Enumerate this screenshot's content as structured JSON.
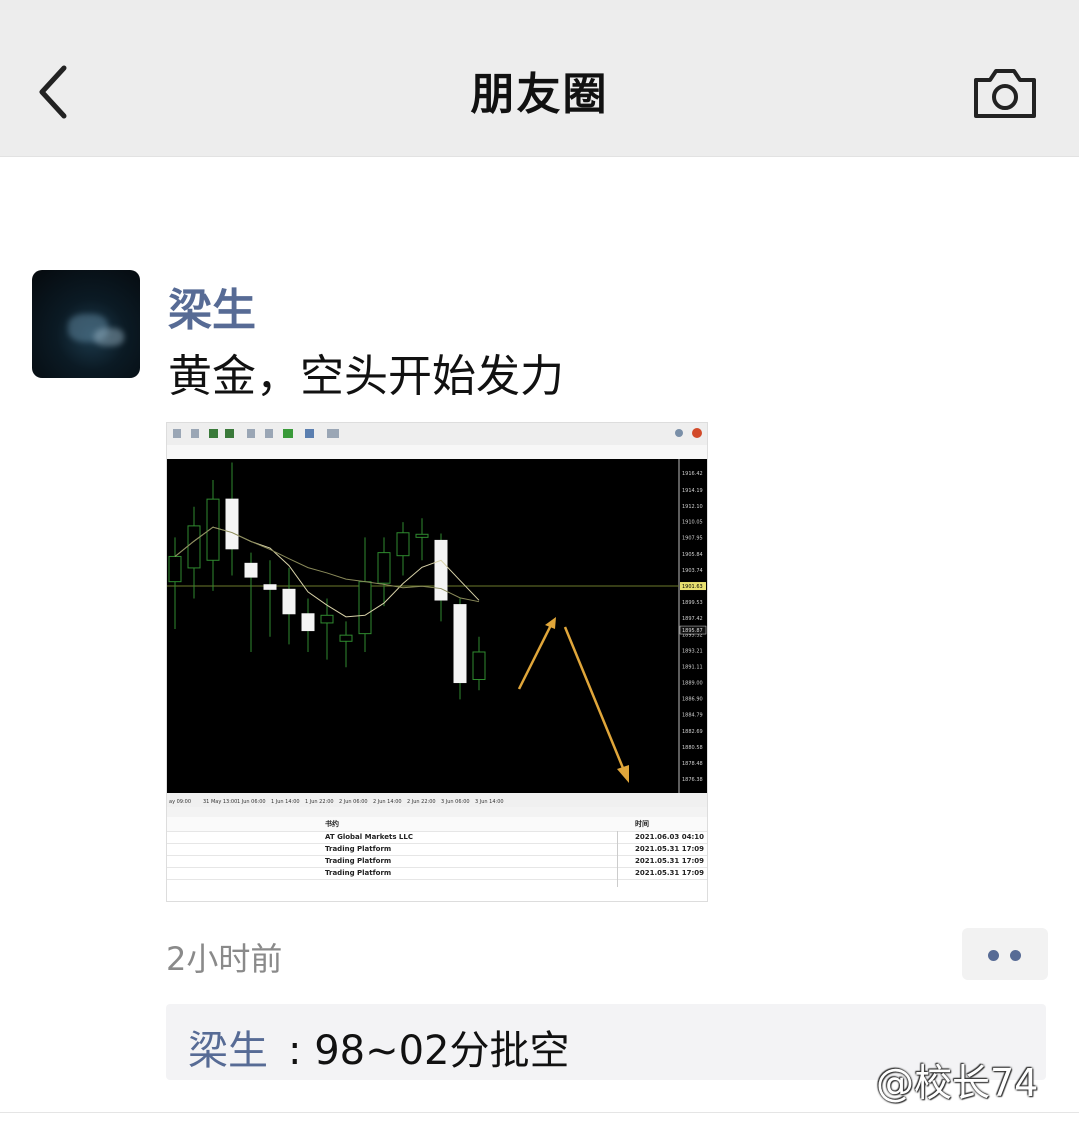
{
  "nav": {
    "title": "朋友圈",
    "back_icon": "chevron-left-icon",
    "camera_icon": "camera-icon"
  },
  "post": {
    "author": "梁生",
    "text": "黄金，空头开始发力",
    "time": "2小时前",
    "image": {
      "chart_data": {
        "type": "candlestick",
        "title": "",
        "x_tick_labels": [
          "ay 09:00",
          "31 May 13:00",
          "1 Jun 06:00",
          "1 Jun 14:00",
          "1 Jun 22:00",
          "2 Jun 06:00",
          "2 Jun 14:00",
          "2 Jun 22:00",
          "3 Jun 06:00",
          "3 Jun 14:00"
        ],
        "candles": [
          {
            "open": 1902.2,
            "close": 1905.5,
            "high": 1908,
            "low": 1896
          },
          {
            "open": 1904.0,
            "close": 1909.5,
            "high": 1912,
            "low": 1900
          },
          {
            "open": 1905.0,
            "close": 1913.0,
            "high": 1915.5,
            "low": 1901
          },
          {
            "open": 1913.0,
            "close": 1906.5,
            "high": 1917.8,
            "low": 1903
          },
          {
            "open": 1904.6,
            "close": 1902.8,
            "high": 1906,
            "low": 1893
          },
          {
            "open": 1901.8,
            "close": 1901.2,
            "high": 1905,
            "low": 1895
          },
          {
            "open": 1901.2,
            "close": 1898.0,
            "high": 1904,
            "low": 1894
          },
          {
            "open": 1898.0,
            "close": 1895.8,
            "high": 1900,
            "low": 1893
          },
          {
            "open": 1896.8,
            "close": 1897.8,
            "high": 1900,
            "low": 1892
          },
          {
            "open": 1894.4,
            "close": 1895.2,
            "high": 1897,
            "low": 1891
          },
          {
            "open": 1895.4,
            "close": 1902.2,
            "high": 1908,
            "low": 1893
          },
          {
            "open": 1902.0,
            "close": 1906.0,
            "high": 1908,
            "low": 1899
          },
          {
            "open": 1905.6,
            "close": 1908.6,
            "high": 1910,
            "low": 1903
          },
          {
            "open": 1908.0,
            "close": 1908.4,
            "high": 1910.5,
            "low": 1905
          },
          {
            "open": 1907.6,
            "close": 1899.8,
            "high": 1908.5,
            "low": 1897
          },
          {
            "open": 1899.2,
            "close": 1889.0,
            "high": 1900,
            "low": 1886.8
          },
          {
            "open": 1889.4,
            "close": 1893.0,
            "high": 1895,
            "low": 1888
          }
        ],
        "price_ticks": [
          "1916.42",
          "1914.19",
          "1912.10",
          "1910.05",
          "1907.95",
          "1905.84",
          "1903.74",
          "1901.63",
          "1899.53",
          "1897.42",
          "1895.32",
          "1893.21",
          "1891.11",
          "1889.00",
          "1886.90",
          "1884.79",
          "1882.69",
          "1880.58",
          "1878.48",
          "1876.38"
        ],
        "current_price_label": "1901.63",
        "bid_label": "1895.87"
      },
      "terminal": {
        "header_col1": "书约",
        "header_col2": "时间",
        "rows": [
          {
            "name": "AT Global Markets LLC",
            "time": "2021.06.03 04:10"
          },
          {
            "name": "Trading Platform",
            "time": "2021.05.31 17:09"
          },
          {
            "name": "Trading Platform",
            "time": "2021.05.31 17:09"
          },
          {
            "name": "Trading Platform",
            "time": "2021.05.31 17:09"
          }
        ]
      }
    }
  },
  "comment": {
    "author": "梁生",
    "text": ": 98~02分批空"
  },
  "watermark": "@校长74",
  "colors": {
    "link_blue": "#576b95",
    "chart_bg": "#000000",
    "arrow_gold": "#e0a63a"
  }
}
